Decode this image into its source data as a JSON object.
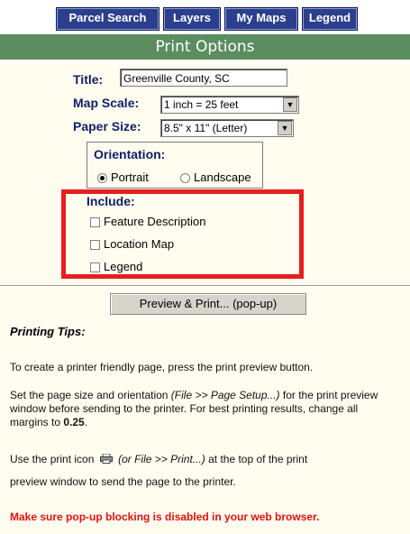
{
  "nav": {
    "parcel_search": "Parcel Search",
    "layers": "Layers",
    "my_maps": "My Maps",
    "legend": "Legend"
  },
  "header": {
    "title": "Print Options"
  },
  "form": {
    "title_label": "Title:",
    "title_value": "Greenville County, SC",
    "map_scale_label": "Map Scale:",
    "map_scale_value": "1 inch = 25 feet",
    "paper_size_label": "Paper Size:",
    "paper_size_value": "8.5\" x 11\" (Letter)",
    "orientation_label": "Orientation:",
    "orientation_portrait": "Portrait",
    "orientation_landscape": "Landscape",
    "orientation_selected": "Portrait",
    "include_label": "Include:",
    "include_items": [
      {
        "label": "Feature Description",
        "checked": false
      },
      {
        "label": "Location Map",
        "checked": false
      },
      {
        "label": "Legend",
        "checked": false
      }
    ]
  },
  "preview_button": "Preview & Print... (pop-up)",
  "tips": {
    "heading": "Printing Tips:",
    "p1": "To create a printer friendly page, press the print preview button.",
    "p2_a": "Set the page size and orientation ",
    "p2_italic": "(File >> Page Setup...)",
    "p2_b": " for the print preview window before sending to the printer. For best printing results, change all margins to ",
    "p2_bold": "0.25",
    "p2_end": ".",
    "p3_a": "Use the print icon",
    "p3_italic": "(or File >> Print...)",
    "p3_b": " at the top of the print",
    "p3_line2": "preview window to send the page to the printer.",
    "warning": "Make sure pop-up blocking is disabled in your web browser."
  },
  "colors": {
    "nav_bg": "#2c3f8c",
    "header_bg": "#5b8d5f",
    "highlight_red": "#e61e1e",
    "warning_red": "#e01010"
  }
}
